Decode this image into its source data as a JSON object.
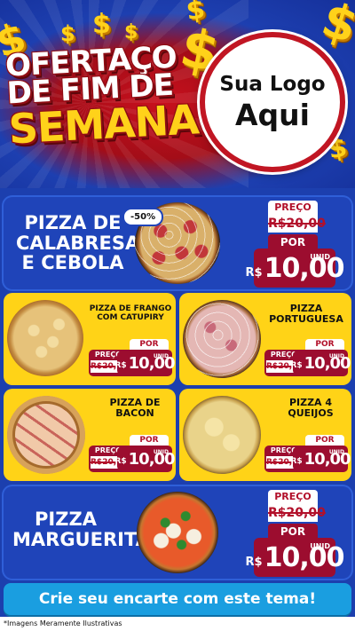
{
  "header": {
    "title_line1": "OFERTAÇO",
    "title_line2": "DE FIM DE",
    "title_line3": "SEMANA",
    "logo_line1": "Sua Logo",
    "logo_line2": "Aqui"
  },
  "colors": {
    "blue": "#1f44b9",
    "yellow": "#ffd317",
    "red": "#9c0d2f",
    "cta": "#1a9ee0"
  },
  "products": {
    "calabresa": {
      "name": "PIZZA DE CALABRESA E CEBOLA",
      "badge": "-50%",
      "preco_label": "PREÇO",
      "old_price": "R$20,00",
      "por_label": "POR",
      "currency": "R$",
      "new_price": "10,00",
      "unit": "UNID"
    },
    "frango": {
      "name": "PIZZA DE FRANGO COM CATUPIRY",
      "preco_label": "PREÇO",
      "old_price": "R$20,00",
      "por_label": "POR",
      "currency": "R$",
      "new_price": "10,00",
      "unit": "UNID"
    },
    "portuguesa": {
      "name": "PIZZA PORTUGUESA",
      "preco_label": "PREÇO",
      "old_price": "R$20,00",
      "por_label": "POR",
      "currency": "R$",
      "new_price": "10,00",
      "unit": "UNID"
    },
    "bacon": {
      "name": "PIZZA DE BACON",
      "preco_label": "PREÇO",
      "old_price": "R$20,00",
      "por_label": "POR",
      "currency": "R$",
      "new_price": "10,00",
      "unit": "UNID"
    },
    "quatro": {
      "name": "PIZZA 4 QUEIJOS",
      "preco_label": "PREÇO",
      "old_price": "R$20,00",
      "por_label": "POR",
      "currency": "R$",
      "new_price": "10,00",
      "unit": "UNID"
    },
    "marguerita": {
      "name": "PIZZA MARGUERITA",
      "preco_label": "PREÇO",
      "old_price": "R$20,00",
      "por_label": "POR",
      "currency": "R$",
      "new_price": "10,00",
      "unit": "UNID"
    }
  },
  "cta": {
    "label": "Crie seu encarte com este tema!"
  },
  "footer": {
    "note": "*Imagens Meramente Ilustrativas"
  }
}
